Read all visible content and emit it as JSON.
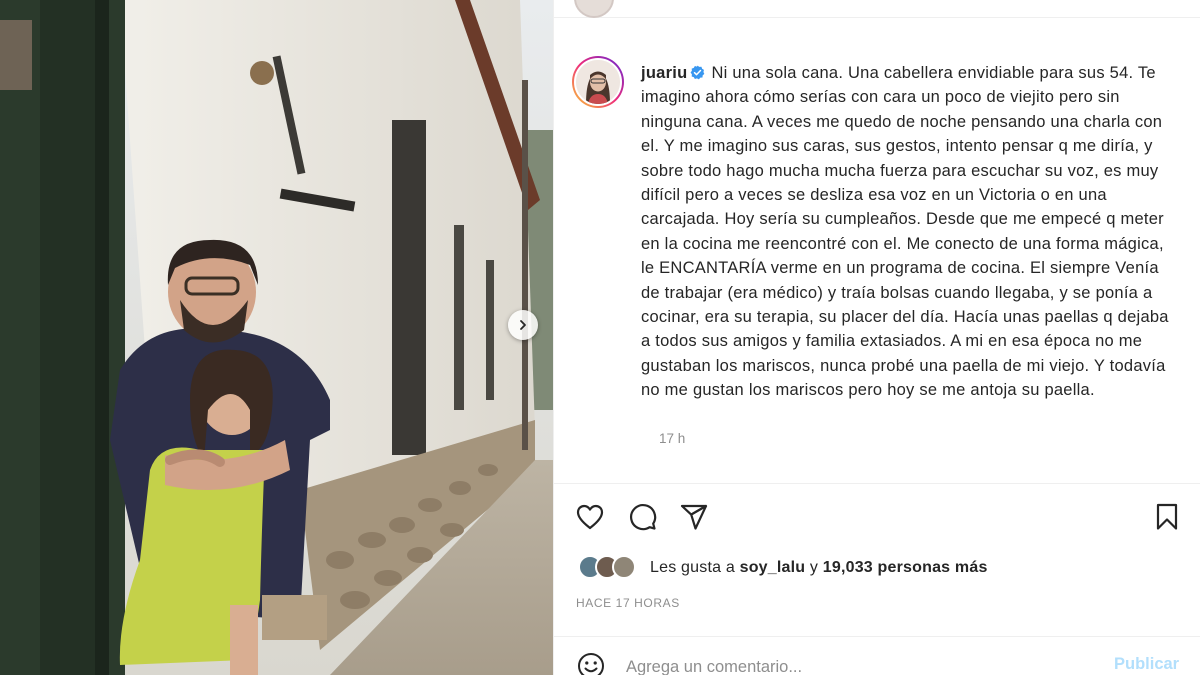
{
  "post": {
    "username": "juariu",
    "caption": "Ni una sola cana. Una cabellera envidiable para sus 54. Te imagino ahora cómo serías con cara un poco de viejito pero sin ninguna cana. A veces me quedo de noche pensando una charla con el. Y me imagino sus caras, sus gestos, intento pensar q me diría, y sobre todo hago mucha mucha fuerza para escuchar su voz, es muy difícil pero a veces se desliza esa voz en un Victoria o en una carcajada. Hoy sería su cumpleaños. Desde que me empecé q meter en la cocina me reencontré con el. Me conecto de una forma mágica, le ENCANTARÍA verme en un programa de cocina. El siempre Venía de trabajar (era médico) y traía bolsas cuando llegaba, y se ponía a cocinar, era su terapia, su placer del día. Hacía unas paellas q dejaba a todos sus amigos y familia extasiados. A mi en esa época no me gustaban los mariscos, nunca probé una paella de mi viejo. Y todavía no me gustan los mariscos pero hoy se me antoja su paella.",
    "caption_age": "17 h",
    "likes_prefix": "Les gusta a",
    "likes_user": "soy_lalu",
    "likes_connector": "y",
    "likes_count": "19,033 personas más",
    "post_time": "HACE 17 HORAS"
  },
  "comment": {
    "placeholder": "Agrega un comentario...",
    "publish_label": "Publicar"
  },
  "icons": {
    "verified": "verified-badge-icon",
    "like": "heart-icon",
    "comment": "comment-bubble-icon",
    "share": "paper-plane-icon",
    "save": "bookmark-icon",
    "emoji": "smiley-icon",
    "next": "chevron-right-icon"
  },
  "colors": {
    "verified": "#3897f0",
    "text": "#262626",
    "muted": "#8e8e8e",
    "publish_disabled": "#b2dffc"
  }
}
